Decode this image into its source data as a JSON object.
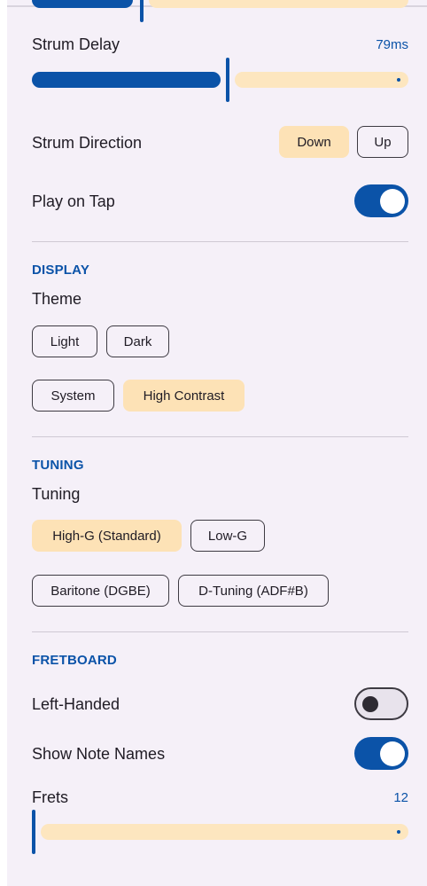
{
  "strum_delay": {
    "label": "Strum Delay",
    "value_text": "79ms",
    "fraction": 0.52
  },
  "strum_direction": {
    "label": "Strum Direction",
    "options": [
      "Down",
      "Up"
    ],
    "selected": "Down"
  },
  "play_on_tap": {
    "label": "Play on Tap",
    "on": true
  },
  "display": {
    "section_title": "DISPLAY",
    "theme_label": "Theme",
    "themes": [
      "Light",
      "Dark",
      "System",
      "High Contrast"
    ],
    "selected_theme": "High Contrast"
  },
  "tuning": {
    "section_title": "TUNING",
    "tuning_label": "Tuning",
    "options": [
      "High-G (Standard)",
      "Low-G",
      "Baritone (DGBE)",
      "D-Tuning (ADF#B)"
    ],
    "selected": "High-G (Standard)"
  },
  "fretboard": {
    "section_title": "FRETBOARD",
    "left_handed": {
      "label": "Left-Handed",
      "on": false
    },
    "show_note_names": {
      "label": "Show Note Names",
      "on": true
    },
    "frets": {
      "label": "Frets",
      "value_text": "12",
      "fraction": 0.0
    }
  },
  "colors": {
    "accent": "#0b53a8",
    "selected_chip": "#fde2b6",
    "inactive_track": "#fde6bf",
    "background": "#f5f0f8"
  }
}
